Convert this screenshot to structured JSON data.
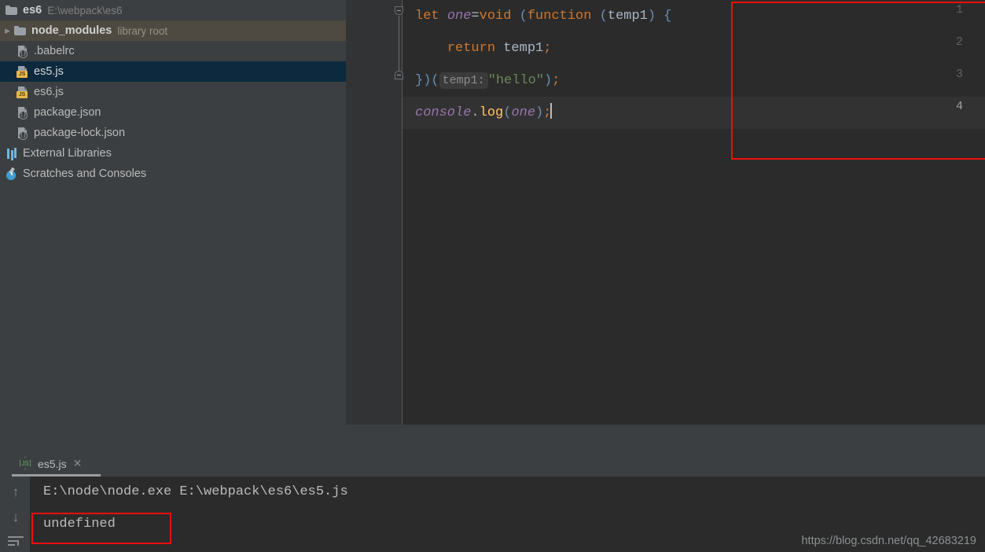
{
  "project": {
    "root": {
      "name": "es6",
      "path": "E:\\webpack\\es6",
      "icon": "folder-icon"
    },
    "items": [
      {
        "name": "node_modules",
        "tag": "library root",
        "icon": "folder-icon",
        "type": "folder",
        "expandable": true,
        "state": "library-root"
      },
      {
        "name": ".babelrc",
        "tag": "",
        "icon": "json-file-icon",
        "type": "json",
        "expandable": false,
        "state": "normal"
      },
      {
        "name": "es5.js",
        "tag": "",
        "icon": "js-file-icon",
        "type": "js",
        "expandable": false,
        "state": "selected"
      },
      {
        "name": "es6.js",
        "tag": "",
        "icon": "js-file-icon",
        "type": "js",
        "expandable": false,
        "state": "normal"
      },
      {
        "name": "package.json",
        "tag": "",
        "icon": "json-file-icon",
        "type": "json",
        "expandable": false,
        "state": "normal"
      },
      {
        "name": "package-lock.json",
        "tag": "",
        "icon": "json-file-icon",
        "type": "json",
        "expandable": false,
        "state": "normal"
      }
    ],
    "external_libraries": {
      "name": "External Libraries",
      "icon": "libraries-icon"
    },
    "scratches": {
      "name": "Scratches and Consoles",
      "icon": "scratches-icon"
    }
  },
  "editor": {
    "line_numbers": [
      "1",
      "2",
      "3",
      "4"
    ],
    "current_line": 4,
    "lines": [
      {
        "n": "1",
        "tokens": [
          {
            "t": "let",
            "c": "k"
          },
          {
            "t": " ",
            "c": "op"
          },
          {
            "t": "one",
            "c": "v"
          },
          {
            "t": "=",
            "c": "op"
          },
          {
            "t": "void",
            "c": "k"
          },
          {
            "t": " ",
            "c": "op"
          },
          {
            "t": "(",
            "c": "p"
          },
          {
            "t": "function",
            "c": "k"
          },
          {
            "t": " ",
            "c": "op"
          },
          {
            "t": "(",
            "c": "p"
          },
          {
            "t": "temp1",
            "c": "pn"
          },
          {
            "t": ")",
            "c": "p"
          },
          {
            "t": " ",
            "c": "op"
          },
          {
            "t": "{",
            "c": "p"
          }
        ]
      },
      {
        "n": "2",
        "tokens": [
          {
            "t": "    ",
            "c": "op"
          },
          {
            "t": "return",
            "c": "k"
          },
          {
            "t": " ",
            "c": "op"
          },
          {
            "t": "temp1",
            "c": "op"
          },
          {
            "t": ";",
            "c": "k"
          }
        ]
      },
      {
        "n": "3",
        "tokens": [
          {
            "t": "}",
            "c": "p"
          },
          {
            "t": ")",
            "c": "p"
          },
          {
            "t": "(",
            "c": "p"
          },
          {
            "t": "temp1:",
            "c": "hint"
          },
          {
            "t": "\"hello\"",
            "c": "s"
          },
          {
            "t": ")",
            "c": "p"
          },
          {
            "t": ";",
            "c": "k"
          }
        ]
      },
      {
        "n": "4",
        "tokens": [
          {
            "t": "console",
            "c": "v"
          },
          {
            "t": ".",
            "c": "op"
          },
          {
            "t": "log",
            "c": "f"
          },
          {
            "t": "(",
            "c": "p"
          },
          {
            "t": "one",
            "c": "v"
          },
          {
            "t": ")",
            "c": "p"
          },
          {
            "t": ";",
            "c": "k"
          }
        ]
      }
    ],
    "plain_text": "let one=void (function (temp1) {\n    return temp1;\n})( temp1: \"hello\");\nconsole.log(one);",
    "line1": {
      "kw_let": "let",
      "var_one": "one",
      "eq": "=",
      "kw_void": "void",
      "open_paren": "(",
      "kw_function": "function",
      "paren2": "(",
      "param": "temp1",
      "close_paren": ")",
      "brace": "{"
    },
    "line2": {
      "kw_return": "return",
      "param": "temp1",
      "semi": ";"
    },
    "line3": {
      "close_brace": "}",
      "call_close": ")",
      "call_open": "(",
      "hint": "temp1:",
      "string": "\"hello\"",
      "paren_close": ")",
      "semi": ";"
    },
    "line4": {
      "obj": "console",
      "dot": ".",
      "method": "log",
      "paren_open": "(",
      "arg": "one",
      "paren_close": ")",
      "semi": ";"
    },
    "fold_markers": [
      "fold-open-icon",
      "fold-close-icon"
    ],
    "highlight_box_color": "#f20d0d"
  },
  "run_panel": {
    "label_truncated": ":",
    "tab": {
      "name": "es5.js",
      "icon": "nodejs-icon",
      "close_icon": "close-icon"
    },
    "toolbar": [
      "arrow-up-icon",
      "arrow-down-icon",
      "soft-wrap-icon"
    ],
    "output": [
      "E:\\node\\node.exe E:\\webpack\\es6\\es5.js",
      "undefined"
    ],
    "command_line": "E:\\node\\node.exe E:\\webpack\\es6\\es5.js",
    "result_line": "undefined",
    "highlight_box_color": "#f20d0d"
  },
  "watermark": "https://blog.csdn.net/qq_42683219",
  "colors": {
    "sidebar_bg": "#3c3f41",
    "editor_bg": "#2b2b2b",
    "gutter_bg": "#313335",
    "selection_bg": "#0d293e",
    "library_root_bg": "#4e4a41",
    "keyword": "#cc7832",
    "variable": "#9876aa",
    "string": "#6a8759",
    "function": "#ffc66d",
    "paren": "#6a8fb5",
    "plain": "#a9b7c6",
    "highlight_red": "#f20d0d"
  }
}
